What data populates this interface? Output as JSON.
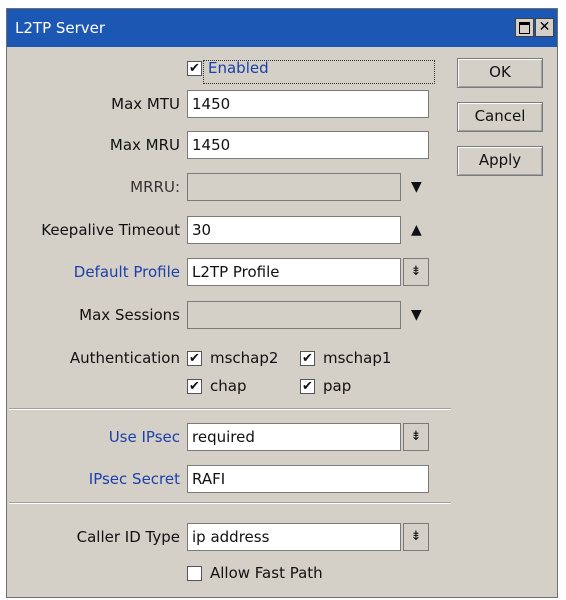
{
  "window": {
    "title": "L2TP Server"
  },
  "buttons": {
    "ok": "OK",
    "cancel": "Cancel",
    "apply": "Apply"
  },
  "titlebar_buttons": {
    "close": "✕"
  },
  "form": {
    "enabled_label": "Enabled",
    "enabled_checked": true,
    "max_mtu_label": "Max MTU",
    "max_mtu_value": "1450",
    "max_mru_label": "Max MRU",
    "max_mru_value": "1450",
    "mrru_label": "MRRU:",
    "mrru_value": "",
    "keepalive_label": "Keepalive Timeout",
    "keepalive_value": "30",
    "default_profile_label": "Default Profile",
    "default_profile_value": "L2TP Profile",
    "max_sessions_label": "Max Sessions",
    "max_sessions_value": "",
    "authentication_label": "Authentication",
    "auth_options": {
      "mschap2": "mschap2",
      "mschap1": "mschap1",
      "chap": "chap",
      "pap": "pap"
    },
    "use_ipsec_label": "Use IPsec",
    "use_ipsec_value": "required",
    "ipsec_secret_label": "IPsec Secret",
    "ipsec_secret_value": "RAFI",
    "caller_id_type_label": "Caller ID Type",
    "caller_id_type_value": "ip address",
    "allow_fast_path_label": "Allow Fast Path",
    "allow_fast_path_checked": false
  },
  "glyphs": {
    "check": "✔",
    "down_arrow": "▼",
    "up_arrow": "▲",
    "dropdown": "⇟"
  },
  "colors": {
    "titlebar": "#1c57b4",
    "link_label": "#1c3fa8",
    "window_bg": "#d4d0c8"
  }
}
